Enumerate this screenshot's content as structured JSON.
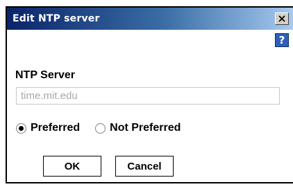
{
  "dialog": {
    "title": "Edit NTP server",
    "close_icon": "close-icon",
    "help_label": "?",
    "help_icon": "help-icon"
  },
  "form": {
    "server_label": "NTP Server",
    "server_placeholder": "time.mit.edu",
    "server_value": "",
    "radio_options": [
      {
        "label": "Preferred",
        "checked": true
      },
      {
        "label": "Not Preferred",
        "checked": false
      }
    ]
  },
  "buttons": {
    "ok_label": "OK",
    "cancel_label": "Cancel"
  }
}
